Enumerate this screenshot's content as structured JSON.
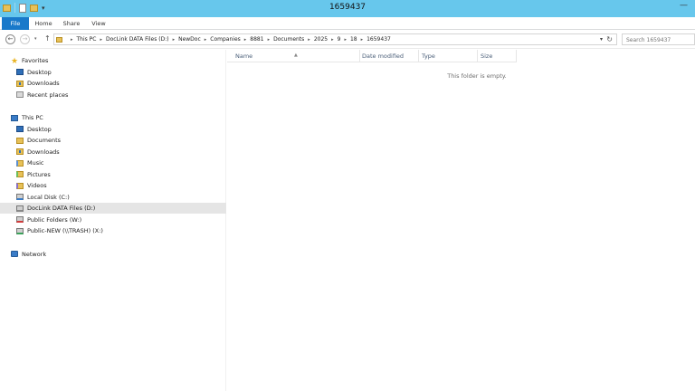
{
  "window": {
    "title": "1659437"
  },
  "ribbon": {
    "tabs": [
      {
        "label": "File"
      },
      {
        "label": "Home"
      },
      {
        "label": "Share"
      },
      {
        "label": "View"
      }
    ]
  },
  "address": {
    "crumbs": [
      "This PC",
      "DocLink DATA Files (D:)",
      "NewDoc",
      "Companies",
      "8881",
      "Documents",
      "2025",
      "9",
      "18",
      "1659437"
    ],
    "search_placeholder": "Search 1659437"
  },
  "nav": {
    "favorites": {
      "label": "Favorites",
      "items": [
        {
          "label": "Desktop",
          "icon": "desktop-icon"
        },
        {
          "label": "Downloads",
          "icon": "downloads-icon"
        },
        {
          "label": "Recent places",
          "icon": "recent-places-icon"
        }
      ]
    },
    "this_pc": {
      "label": "This PC",
      "items": [
        {
          "label": "Desktop",
          "icon": "desktop-icon"
        },
        {
          "label": "Documents",
          "icon": "folder-icon"
        },
        {
          "label": "Downloads",
          "icon": "downloads-icon"
        },
        {
          "label": "Music",
          "icon": "music-icon"
        },
        {
          "label": "Pictures",
          "icon": "pictures-icon"
        },
        {
          "label": "Videos",
          "icon": "videos-icon"
        },
        {
          "label": "Local Disk (C:)",
          "icon": "disk-icon"
        },
        {
          "label": "DocLink DATA Files (D:)",
          "icon": "disk-icon",
          "selected": true
        },
        {
          "label": "Public Folders (W:)",
          "icon": "network-drive-icon"
        },
        {
          "label": "Public-NEW (\\\\TRASH) (X:)",
          "icon": "network-drive-icon"
        }
      ]
    },
    "network": {
      "label": "Network"
    }
  },
  "content": {
    "columns": [
      "Name",
      "Date modified",
      "Type",
      "Size"
    ],
    "empty_message": "This folder is empty."
  },
  "colors": {
    "titlebar": "#67c7ec",
    "file_tab": "#1979ca",
    "selected_row": "#e5e5e5"
  }
}
